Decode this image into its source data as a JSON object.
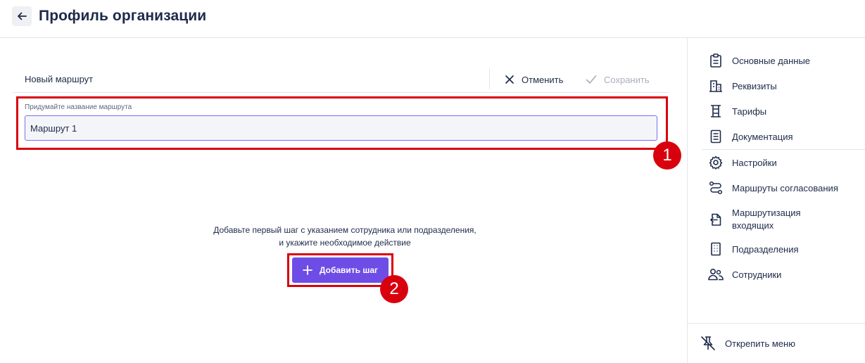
{
  "header": {
    "title": "Профиль организации"
  },
  "route": {
    "title": "Новый маршрут",
    "cancel_label": "Отменить",
    "save_label": "Сохранить"
  },
  "name_field": {
    "label": "Придумайте название маршрута",
    "value": "Маршрут 1"
  },
  "empty_state": {
    "line1": "Добавьте первый шаг с указанием сотрудника или подразделения,",
    "line2": "и укажите необходимое действие",
    "add_step_label": "Добавить шаг"
  },
  "annotations": {
    "badge1": "1",
    "badge2": "2"
  },
  "sidebar": {
    "items": [
      {
        "label": "Основные данные",
        "icon": "clipboard-icon"
      },
      {
        "label": "Реквизиты",
        "icon": "building-icon"
      },
      {
        "label": "Тарифы",
        "icon": "tariff-icon"
      },
      {
        "label": "Документация",
        "icon": "document-icon"
      },
      {
        "label": "Настройки",
        "icon": "gear-icon"
      },
      {
        "label": "Маршруты согласования",
        "icon": "route-icon"
      },
      {
        "label": "Маршрутизация входящих",
        "icon": "incoming-doc-icon"
      },
      {
        "label": "Подразделения",
        "icon": "office-building-icon"
      },
      {
        "label": "Сотрудники",
        "icon": "users-icon"
      }
    ],
    "unpin_label": "Открепить меню"
  },
  "colors": {
    "accent": "#6e4de6",
    "annotation_red": "#d9000d",
    "text_dark": "#1d2a4a",
    "disabled": "#a9b0bd"
  }
}
